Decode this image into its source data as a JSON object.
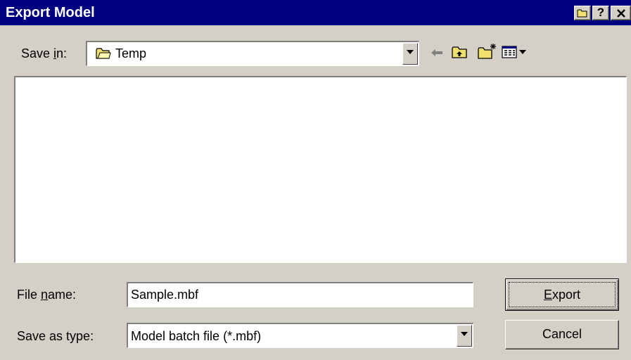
{
  "window": {
    "title": "Export Model"
  },
  "title_buttons": [
    {
      "name": "folder-icon"
    },
    {
      "name": "help-icon",
      "glyph": "?"
    },
    {
      "name": "close-icon",
      "glyph": "x"
    }
  ],
  "save_in": {
    "label_pre": "Save ",
    "label_mnemonic": "i",
    "label_post": "n:",
    "value": "Temp",
    "icon": "folder-icon"
  },
  "toolbar": {
    "icons": [
      "back-arrow-icon",
      "up-one-level-icon",
      "create-new-folder-icon",
      "view-menu-icon"
    ]
  },
  "file_name": {
    "label_pre": "File ",
    "label_mnemonic": "n",
    "label_post": "ame:",
    "value": "Sample.mbf"
  },
  "save_as_type": {
    "label": "Save as type:",
    "value": "Model batch file (*.mbf)"
  },
  "buttons": {
    "export_mnemonic": "E",
    "export_rest": "xport",
    "cancel": "Cancel"
  },
  "colors": {
    "titlebar": "#000080",
    "face": "#d4d0c8",
    "folder": "#f0e070"
  }
}
